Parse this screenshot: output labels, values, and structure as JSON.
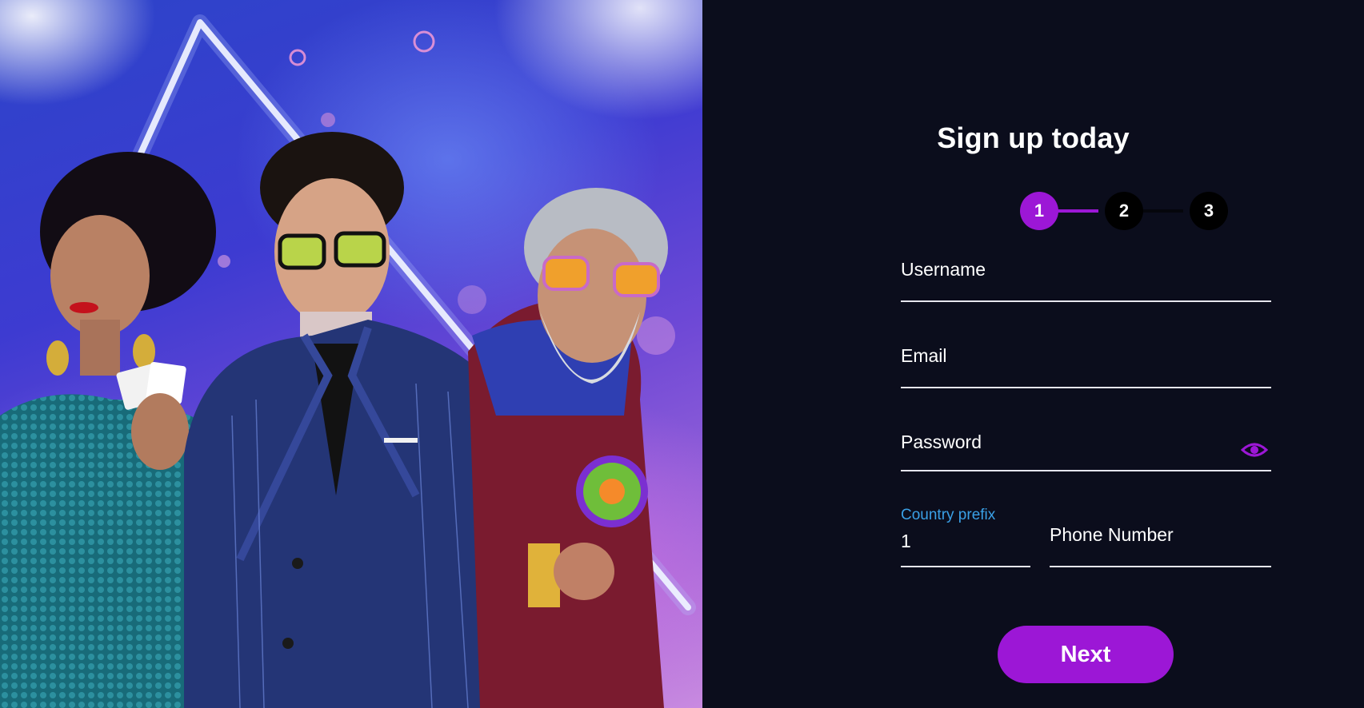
{
  "signup": {
    "title": "Sign up today",
    "steps": [
      "1",
      "2",
      "3"
    ],
    "active_step": 1,
    "fields": {
      "username_label": "Username",
      "email_label": "Email",
      "password_label": "Password",
      "country_prefix_label": "Country prefix",
      "country_prefix_value": "1",
      "phone_label": "Phone Number"
    },
    "next_label": "Next"
  },
  "colors": {
    "accent": "#9c17d6",
    "background": "#0b0d1c",
    "link_blue": "#3aa0e6"
  },
  "icons": {
    "password_toggle": "eye-icon"
  }
}
